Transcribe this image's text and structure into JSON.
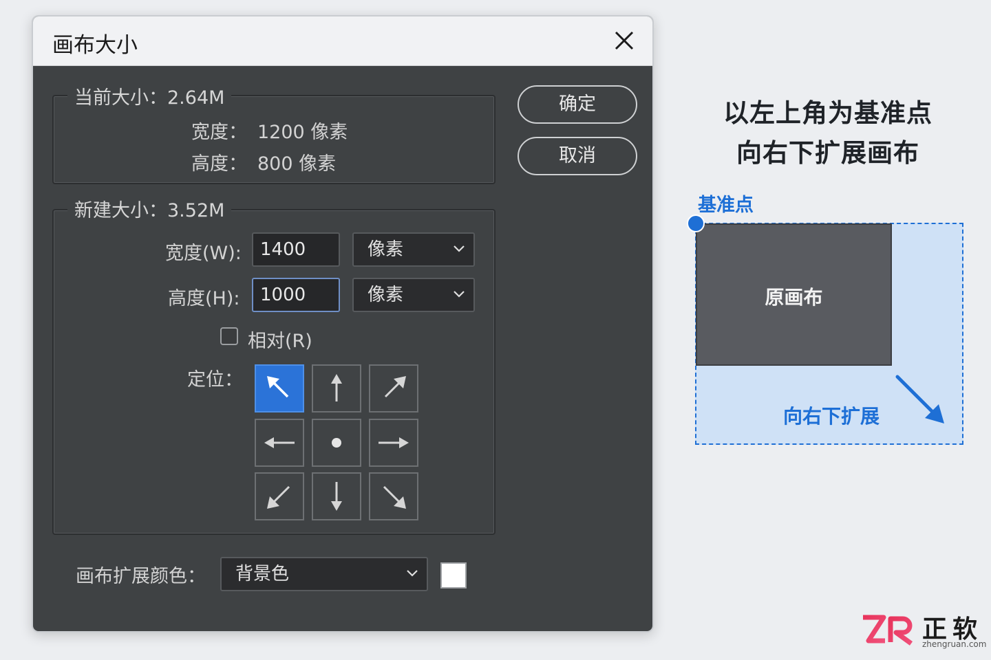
{
  "dialog": {
    "title": "画布大小",
    "current": {
      "legend": "当前大小：2.64M",
      "width_label": "宽度：",
      "width_value": "1200 像素",
      "height_label": "高度：",
      "height_value": "800 像素"
    },
    "new": {
      "legend": "新建大小：3.52M",
      "width_label": "宽度(W):",
      "width_value": "1400",
      "width_unit": "像素",
      "height_label": "高度(H):",
      "height_value": "1000",
      "height_unit": "像素",
      "relative_label": "相对(R)",
      "relative_checked": false,
      "anchor_label": "定位：",
      "anchor_selected": "top-left"
    },
    "extension_color_label": "画布扩展颜色：",
    "extension_color_value": "背景色",
    "extension_swatch_color": "#ffffff",
    "ok_label": "确定",
    "cancel_label": "取消"
  },
  "illustration": {
    "heading_line1": "以左上角为基准点",
    "heading_line2": "向右下扩展画布",
    "anchor_caption": "基准点",
    "original_label": "原画布",
    "expand_label": "向右下扩展",
    "accent_color": "#1e6fd5"
  },
  "logo": {
    "mark": "ZR",
    "name": "正软",
    "url": "zhengruan.com"
  }
}
